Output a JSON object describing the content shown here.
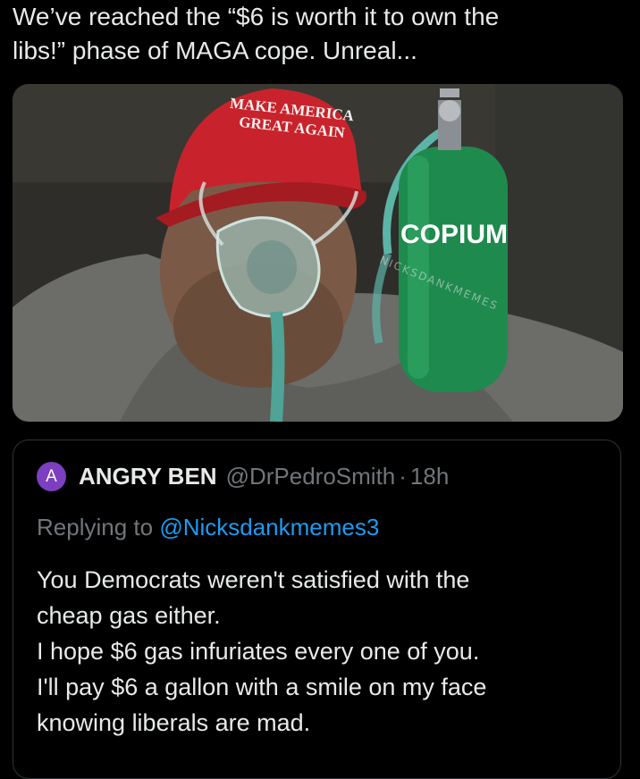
{
  "tweet": {
    "text": "We’ve reached the “$6 is worth it to own the\nlibs!” phase of MAGA cope. Unreal..."
  },
  "media": {
    "hat_line1": "MAKE AMERICA",
    "hat_line2": "GREAT AGAIN",
    "tank_label": "COPIUM",
    "watermark": "NICKSDANKMEMES",
    "colors": {
      "hat": "#c8232c",
      "tank": "#1f8a4e",
      "background": "#2b2b29"
    }
  },
  "quote": {
    "avatar_letter": "A",
    "avatar_color": "#7b3fbf",
    "display_name": "ANGRY BEN",
    "handle": "@DrPedroSmith",
    "separator": "·",
    "time": "18h",
    "replying_prefix": "Replying to ",
    "replying_handle": "@Nicksdankmemes3",
    "lines": [
      "You Democrats weren't satisfied with the",
      "cheap gas either.",
      "I hope $6 gas infuriates every one of you.",
      "I'll pay $6 a gallon with a smile on my face",
      "knowing liberals are mad."
    ]
  }
}
